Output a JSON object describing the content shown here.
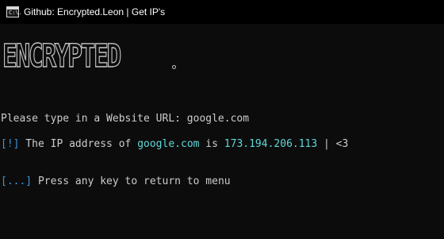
{
  "window": {
    "title": "Github: Encrypted.Leon | Get IP's",
    "icon_text": "C:\\."
  },
  "colors": {
    "background": "#0c0c0c",
    "text": "#cccccc",
    "accent_blue": "#3a96dd",
    "accent_cyan": "#61d6d6"
  },
  "banner": {
    "text": "ENCRYPTED"
  },
  "console": {
    "prompt_line": "Please type in a Website URL: google.com",
    "result": {
      "bracket": "[!]",
      "prefix": " The IP address of ",
      "domain": "google.com",
      "middle": " is ",
      "ip": "173.194.206.113",
      "suffix": " | <3"
    },
    "menu_line": {
      "bracket": "[...]",
      "text": " Press any key to return to menu"
    }
  }
}
